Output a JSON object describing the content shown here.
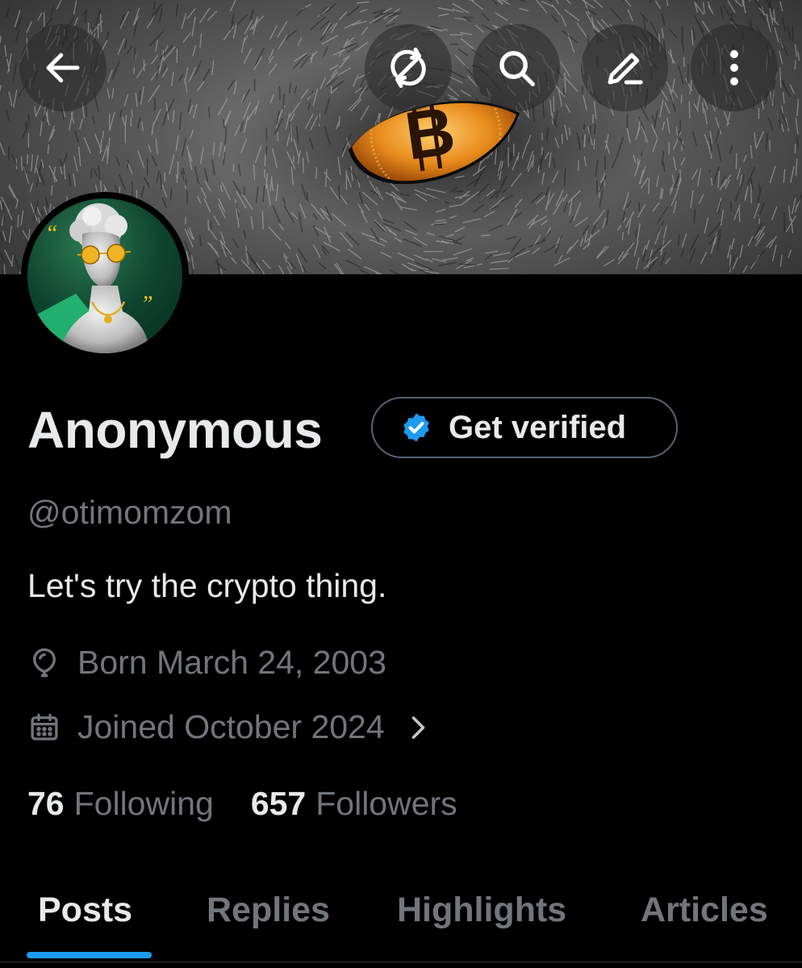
{
  "profile": {
    "display_name": "Anonymous",
    "handle": "@otimomzom",
    "bio": "Let's try the crypto thing.",
    "birth": "Born March 24, 2003",
    "joined": "Joined October 2024"
  },
  "verify_button": {
    "label": "Get verified"
  },
  "stats": {
    "following_count": "76",
    "following_label": "Following",
    "followers_count": "657",
    "followers_label": "Followers"
  },
  "tabs": [
    {
      "label": "Posts",
      "active": true
    },
    {
      "label": "Replies",
      "active": false
    },
    {
      "label": "Highlights",
      "active": false
    },
    {
      "label": "Articles",
      "active": false
    }
  ],
  "header_icons": [
    "back-arrow-icon",
    "sync-icon",
    "search-icon",
    "edit-icon",
    "more-vertical-icon"
  ],
  "colors": {
    "background": "#000000",
    "primary_text": "#e7e9ea",
    "secondary_text": "#71767b",
    "accent": "#1d9bf0",
    "border": "#536471"
  }
}
